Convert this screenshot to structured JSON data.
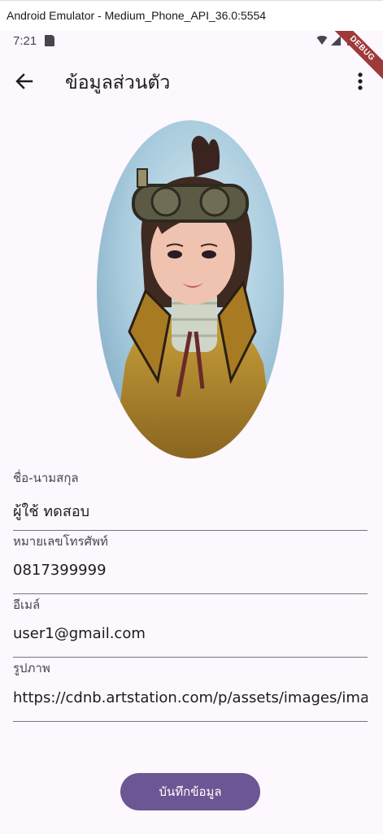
{
  "window": {
    "title": "Android Emulator - Medium_Phone_API_36.0:5554"
  },
  "status_bar": {
    "time": "7:21",
    "debug_label": "DEBUG"
  },
  "app_bar": {
    "title": "ข้อมูลส่วนตัว",
    "back_icon": "arrow-back-icon",
    "menu_icon": "more-vert-icon"
  },
  "profile": {
    "avatar": "steampunk-character-portrait"
  },
  "form": {
    "name": {
      "label": "ชื่อ-นามสกุล",
      "value": "ผู้ใช้ ทดสอบ"
    },
    "phone": {
      "label": "หมายเลขโทรศัพท์",
      "value": "0817399999"
    },
    "email": {
      "label": "อีเมล์",
      "value": "user1@gmail.com"
    },
    "image": {
      "label": "รูปภาพ",
      "value": "https://cdnb.artstation.com/p/assets/images/ima"
    }
  },
  "actions": {
    "save_label": "บันทึกข้อมูล"
  },
  "colors": {
    "background": "#fdf7fe",
    "primary": "#6c5693",
    "text": "#1d1b20",
    "debug": "#9f3a3a"
  }
}
